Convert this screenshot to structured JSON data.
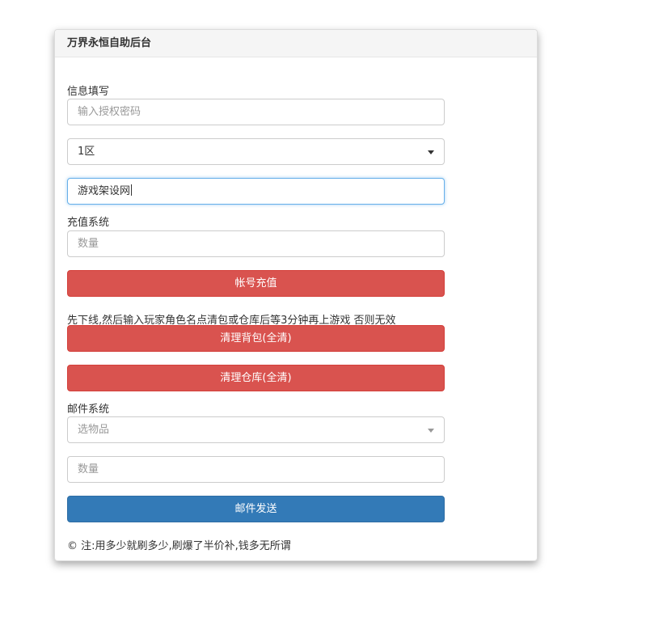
{
  "panel": {
    "title": "万界永恒自助后台"
  },
  "info_section": {
    "label": "信息填写",
    "auth_password": {
      "value": "",
      "placeholder": "输入授权密码"
    },
    "zone_select": {
      "selected": "1区"
    },
    "account_input": {
      "value": "游戏架设网"
    }
  },
  "recharge_section": {
    "label": "充值系统",
    "quantity": {
      "value": "",
      "placeholder": "数量"
    },
    "recharge_button": "帐号充值"
  },
  "cleanup_section": {
    "notice": "先下线,然后输入玩家角色名点清包或仓库后等3分钟再上游戏 否则无效",
    "clear_bag_button": "清理背包(全清)",
    "clear_storage_button": "清理仓库(全清)"
  },
  "mail_section": {
    "label": "邮件系统",
    "item_select": {
      "placeholder": "选物品"
    },
    "quantity": {
      "value": "",
      "placeholder": "数量"
    },
    "send_button": "邮件发送"
  },
  "footer": {
    "note": "© 注:用多少就刷多少,刷爆了半价补,钱多无所谓"
  },
  "colors": {
    "danger": "#d9534f",
    "primary": "#337ab7",
    "focus_border": "#66afe9"
  }
}
